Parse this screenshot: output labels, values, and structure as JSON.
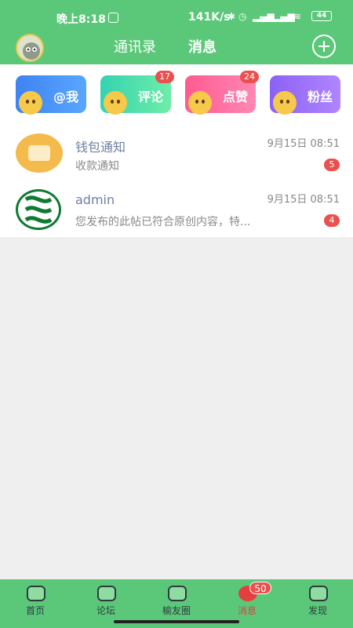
{
  "status": {
    "time": "晚上8:18",
    "network_speed": "141K/s",
    "battery": "44"
  },
  "header": {
    "tabs": [
      {
        "label": "通讯录"
      },
      {
        "label": "消息"
      }
    ]
  },
  "quick_cards": [
    {
      "label": "@我",
      "badge": ""
    },
    {
      "label": "评论",
      "badge": "17"
    },
    {
      "label": "点赞",
      "badge": "24"
    },
    {
      "label": "粉丝",
      "badge": ""
    }
  ],
  "messages": [
    {
      "name": "钱包通知",
      "time": "9月15日 08:51",
      "preview": "收款通知",
      "unread": "5"
    },
    {
      "name": "admin",
      "time": "9月15日 08:51",
      "preview": "您发布的此帖已符合原创内容，特...",
      "unread": "4"
    }
  ],
  "bottom_nav": {
    "items": [
      {
        "label": "首页",
        "icon": "home-icon"
      },
      {
        "label": "论坛",
        "icon": "forum-icon"
      },
      {
        "label": "榆友圈",
        "icon": "heart-icon"
      },
      {
        "label": "消息",
        "icon": "message-icon"
      },
      {
        "label": "发现",
        "icon": "discover-icon"
      }
    ],
    "message_badge": "50"
  },
  "colors": {
    "header_bg": "#5bc879",
    "badge": "#e9504f",
    "active_tab": "#e43f3f"
  }
}
